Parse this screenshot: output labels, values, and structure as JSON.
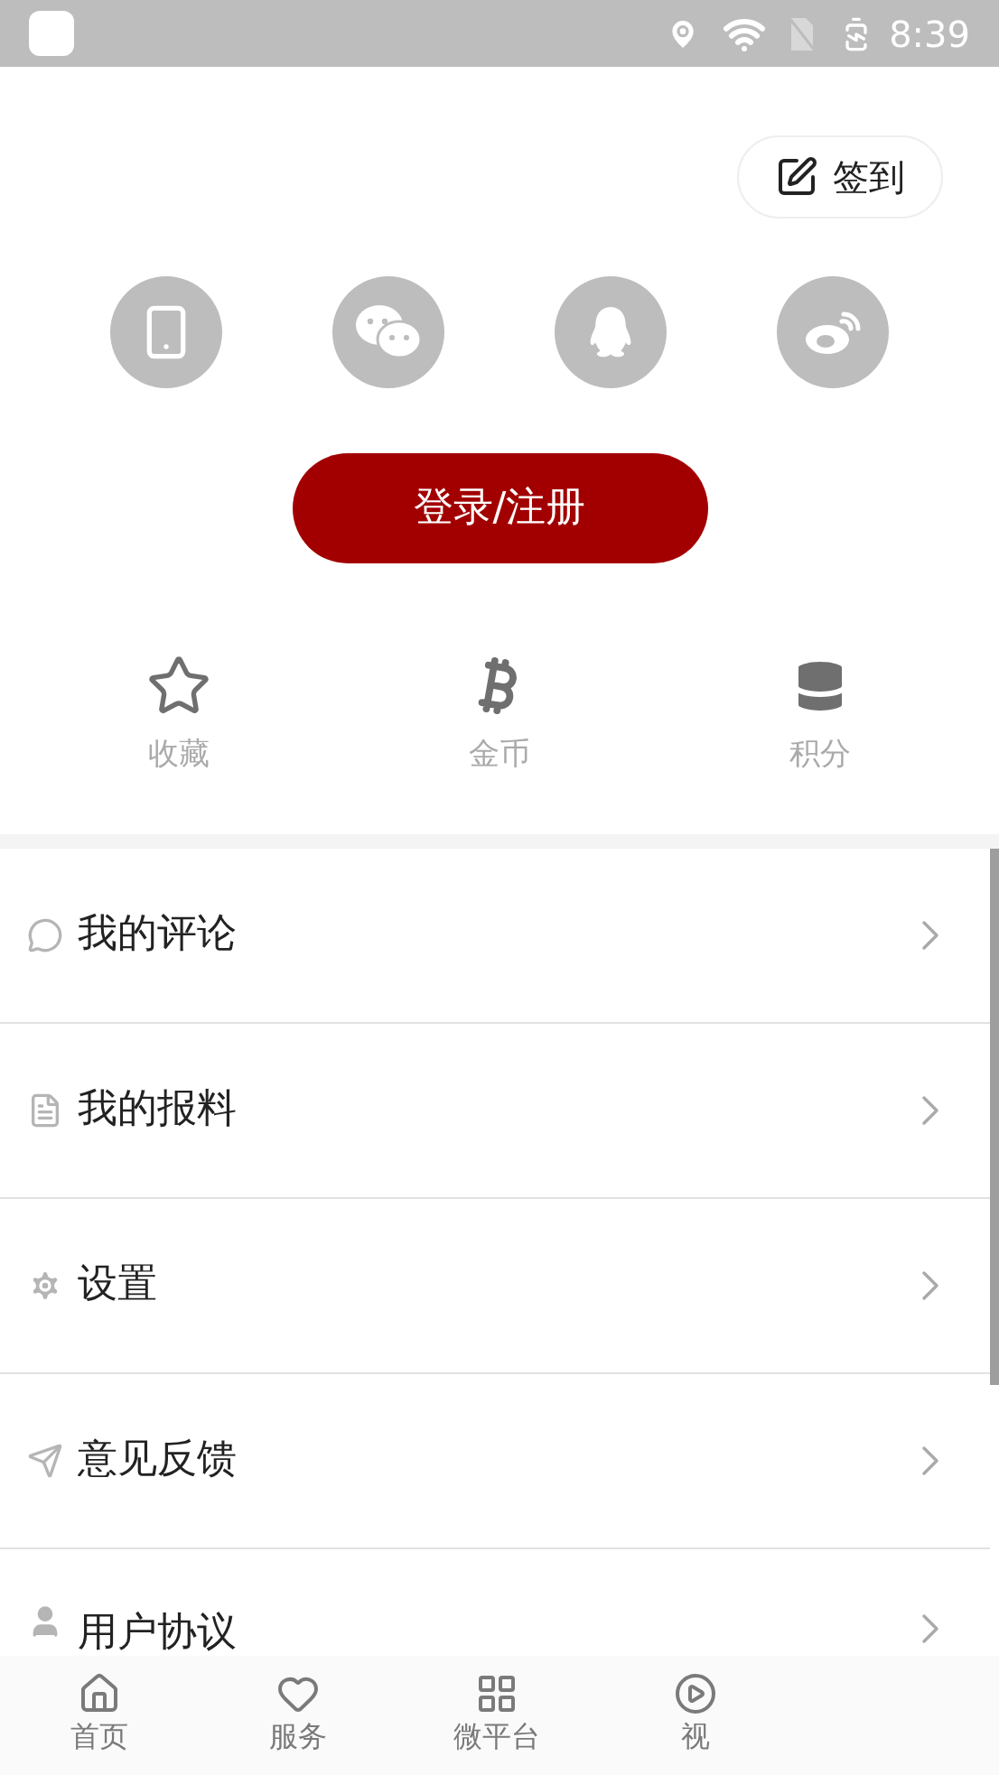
{
  "status_bar": {
    "time": "8:39"
  },
  "checkin_button": {
    "label": "签到"
  },
  "login_options": [
    {
      "kind": "phone"
    },
    {
      "kind": "wechat"
    },
    {
      "kind": "qq"
    },
    {
      "kind": "weibo"
    }
  ],
  "login_button": {
    "label": "登录/注册"
  },
  "stats": [
    {
      "kind": "star",
      "label": "收藏"
    },
    {
      "kind": "coin",
      "label": "金币"
    },
    {
      "kind": "database",
      "label": "积分"
    }
  ],
  "menu": [
    {
      "kind": "comment",
      "label": "我的评论"
    },
    {
      "kind": "document",
      "label": "我的报料"
    },
    {
      "kind": "gear",
      "label": "设置"
    },
    {
      "kind": "send",
      "label": "意见反馈"
    },
    {
      "kind": "user",
      "label": "用户协议"
    }
  ],
  "tab_bar": [
    {
      "kind": "home",
      "label": "首页"
    },
    {
      "kind": "heart",
      "label": "服务"
    },
    {
      "kind": "grid",
      "label": "微平台"
    },
    {
      "kind": "video",
      "label": "视"
    }
  ]
}
